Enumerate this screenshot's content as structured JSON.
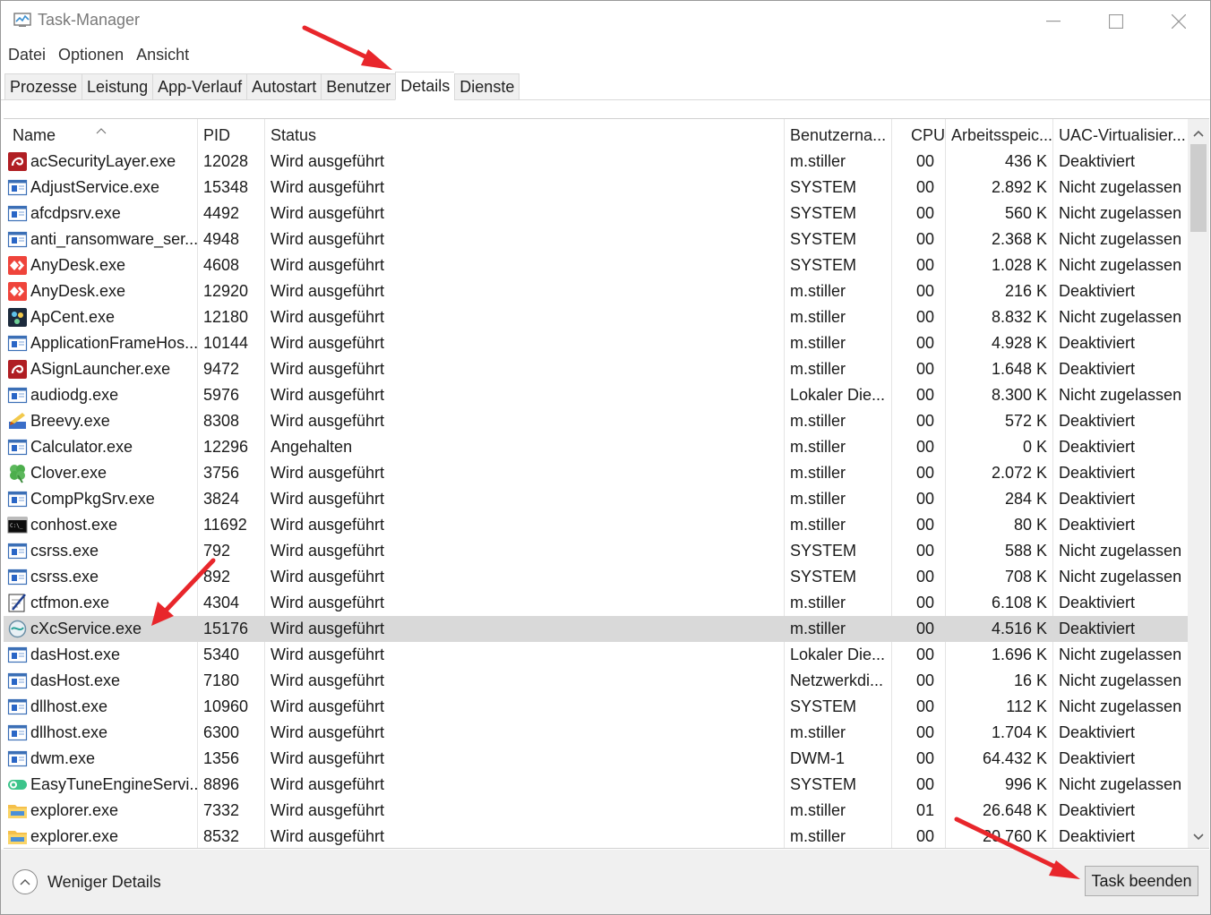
{
  "window": {
    "title": "Task-Manager",
    "controls": {
      "minimize": "minimize-icon",
      "maximize": "maximize-icon",
      "close": "close-icon"
    }
  },
  "menu": [
    "Datei",
    "Optionen",
    "Ansicht"
  ],
  "tabs": [
    {
      "label": "Prozesse",
      "active": false
    },
    {
      "label": "Leistung",
      "active": false
    },
    {
      "label": "App-Verlauf",
      "active": false
    },
    {
      "label": "Autostart",
      "active": false
    },
    {
      "label": "Benutzer",
      "active": false
    },
    {
      "label": "Details",
      "active": true
    },
    {
      "label": "Dienste",
      "active": false
    }
  ],
  "table": {
    "columns": {
      "name": "Name",
      "pid": "PID",
      "status": "Status",
      "user": "Benutzerna...",
      "cpu": "CPU",
      "memory": "Arbeitsspeic...",
      "uac": "UAC-Virtualisier..."
    },
    "sort": {
      "column": "name",
      "direction": "ascending"
    },
    "rows": [
      {
        "icon": "acrobat-security-icon",
        "name": "acSecurityLayer.exe",
        "pid": "12028",
        "status": "Wird ausgeführt",
        "user": "m.stiller",
        "cpu": "00",
        "memory": "436 K",
        "uac": "Deaktiviert"
      },
      {
        "icon": "generic-app-icon",
        "name": "AdjustService.exe",
        "pid": "15348",
        "status": "Wird ausgeführt",
        "user": "SYSTEM",
        "cpu": "00",
        "memory": "2.892 K",
        "uac": "Nicht zugelassen"
      },
      {
        "icon": "generic-app-icon",
        "name": "afcdpsrv.exe",
        "pid": "4492",
        "status": "Wird ausgeführt",
        "user": "SYSTEM",
        "cpu": "00",
        "memory": "560 K",
        "uac": "Nicht zugelassen"
      },
      {
        "icon": "generic-app-icon",
        "name": "anti_ransomware_ser...",
        "pid": "4948",
        "status": "Wird ausgeführt",
        "user": "SYSTEM",
        "cpu": "00",
        "memory": "2.368 K",
        "uac": "Nicht zugelassen"
      },
      {
        "icon": "anydesk-icon",
        "name": "AnyDesk.exe",
        "pid": "4608",
        "status": "Wird ausgeführt",
        "user": "SYSTEM",
        "cpu": "00",
        "memory": "1.028 K",
        "uac": "Nicht zugelassen"
      },
      {
        "icon": "anydesk-icon",
        "name": "AnyDesk.exe",
        "pid": "12920",
        "status": "Wird ausgeführt",
        "user": "m.stiller",
        "cpu": "00",
        "memory": "216 K",
        "uac": "Deaktiviert"
      },
      {
        "icon": "apcent-icon",
        "name": "ApCent.exe",
        "pid": "12180",
        "status": "Wird ausgeführt",
        "user": "m.stiller",
        "cpu": "00",
        "memory": "8.832 K",
        "uac": "Nicht zugelassen"
      },
      {
        "icon": "generic-app-icon",
        "name": "ApplicationFrameHos...",
        "pid": "10144",
        "status": "Wird ausgeführt",
        "user": "m.stiller",
        "cpu": "00",
        "memory": "4.928 K",
        "uac": "Deaktiviert"
      },
      {
        "icon": "acrobat-security-icon",
        "name": "ASignLauncher.exe",
        "pid": "9472",
        "status": "Wird ausgeführt",
        "user": "m.stiller",
        "cpu": "00",
        "memory": "1.648 K",
        "uac": "Deaktiviert"
      },
      {
        "icon": "generic-app-icon",
        "name": "audiodg.exe",
        "pid": "5976",
        "status": "Wird ausgeführt",
        "user": "Lokaler Die...",
        "cpu": "00",
        "memory": "8.300 K",
        "uac": "Nicht zugelassen"
      },
      {
        "icon": "breevy-icon",
        "name": "Breevy.exe",
        "pid": "8308",
        "status": "Wird ausgeführt",
        "user": "m.stiller",
        "cpu": "00",
        "memory": "572 K",
        "uac": "Deaktiviert"
      },
      {
        "icon": "generic-app-icon",
        "name": "Calculator.exe",
        "pid": "12296",
        "status": "Angehalten",
        "user": "m.stiller",
        "cpu": "00",
        "memory": "0 K",
        "uac": "Deaktiviert"
      },
      {
        "icon": "clover-icon",
        "name": "Clover.exe",
        "pid": "3756",
        "status": "Wird ausgeführt",
        "user": "m.stiller",
        "cpu": "00",
        "memory": "2.072 K",
        "uac": "Deaktiviert"
      },
      {
        "icon": "generic-app-icon",
        "name": "CompPkgSrv.exe",
        "pid": "3824",
        "status": "Wird ausgeführt",
        "user": "m.stiller",
        "cpu": "00",
        "memory": "284 K",
        "uac": "Deaktiviert"
      },
      {
        "icon": "console-icon",
        "name": "conhost.exe",
        "pid": "11692",
        "status": "Wird ausgeführt",
        "user": "m.stiller",
        "cpu": "00",
        "memory": "80 K",
        "uac": "Deaktiviert"
      },
      {
        "icon": "generic-app-icon",
        "name": "csrss.exe",
        "pid": "792",
        "status": "Wird ausgeführt",
        "user": "SYSTEM",
        "cpu": "00",
        "memory": "588 K",
        "uac": "Nicht zugelassen"
      },
      {
        "icon": "generic-app-icon",
        "name": "csrss.exe",
        "pid": "892",
        "status": "Wird ausgeführt",
        "user": "SYSTEM",
        "cpu": "00",
        "memory": "708 K",
        "uac": "Nicht zugelassen"
      },
      {
        "icon": "ctfmon-icon",
        "name": "ctfmon.exe",
        "pid": "4304",
        "status": "Wird ausgeführt",
        "user": "m.stiller",
        "cpu": "00",
        "memory": "6.108 K",
        "uac": "Deaktiviert"
      },
      {
        "icon": "cxc-service-icon",
        "name": "cXcService.exe",
        "pid": "15176",
        "status": "Wird ausgeführt",
        "user": "m.stiller",
        "cpu": "00",
        "memory": "4.516 K",
        "uac": "Deaktiviert",
        "selected": true
      },
      {
        "icon": "generic-app-icon",
        "name": "dasHost.exe",
        "pid": "5340",
        "status": "Wird ausgeführt",
        "user": "Lokaler Die...",
        "cpu": "00",
        "memory": "1.696 K",
        "uac": "Nicht zugelassen"
      },
      {
        "icon": "generic-app-icon",
        "name": "dasHost.exe",
        "pid": "7180",
        "status": "Wird ausgeführt",
        "user": "Netzwerkdi...",
        "cpu": "00",
        "memory": "16 K",
        "uac": "Nicht zugelassen"
      },
      {
        "icon": "generic-app-icon",
        "name": "dllhost.exe",
        "pid": "10960",
        "status": "Wird ausgeführt",
        "user": "SYSTEM",
        "cpu": "00",
        "memory": "112 K",
        "uac": "Nicht zugelassen"
      },
      {
        "icon": "generic-app-icon",
        "name": "dllhost.exe",
        "pid": "6300",
        "status": "Wird ausgeführt",
        "user": "m.stiller",
        "cpu": "00",
        "memory": "1.704 K",
        "uac": "Deaktiviert"
      },
      {
        "icon": "generic-app-icon",
        "name": "dwm.exe",
        "pid": "1356",
        "status": "Wird ausgeführt",
        "user": "DWM-1",
        "cpu": "00",
        "memory": "64.432 K",
        "uac": "Deaktiviert"
      },
      {
        "icon": "easytune-icon",
        "name": "EasyTuneEngineServi...",
        "pid": "8896",
        "status": "Wird ausgeführt",
        "user": "SYSTEM",
        "cpu": "00",
        "memory": "996 K",
        "uac": "Nicht zugelassen"
      },
      {
        "icon": "explorer-folder-icon",
        "name": "explorer.exe",
        "pid": "7332",
        "status": "Wird ausgeführt",
        "user": "m.stiller",
        "cpu": "01",
        "memory": "26.648 K",
        "uac": "Deaktiviert"
      },
      {
        "icon": "explorer-folder-icon",
        "name": "explorer.exe",
        "pid": "8532",
        "status": "Wird ausgeführt",
        "user": "m.stiller",
        "cpu": "00",
        "memory": "20.760 K",
        "uac": "Deaktiviert"
      }
    ]
  },
  "footer": {
    "less_details": "Weniger Details",
    "end_task": "Task beenden"
  },
  "annotations": {
    "arrow_color": "#e8262b",
    "arrows": [
      "arrow-to-details-tab",
      "arrow-to-cxcservice-row",
      "arrow-to-end-task-button"
    ]
  },
  "colors": {
    "selected_row": "#d9d9d9",
    "anydesk": "#ef443b",
    "acrobat": "#b01e23"
  }
}
